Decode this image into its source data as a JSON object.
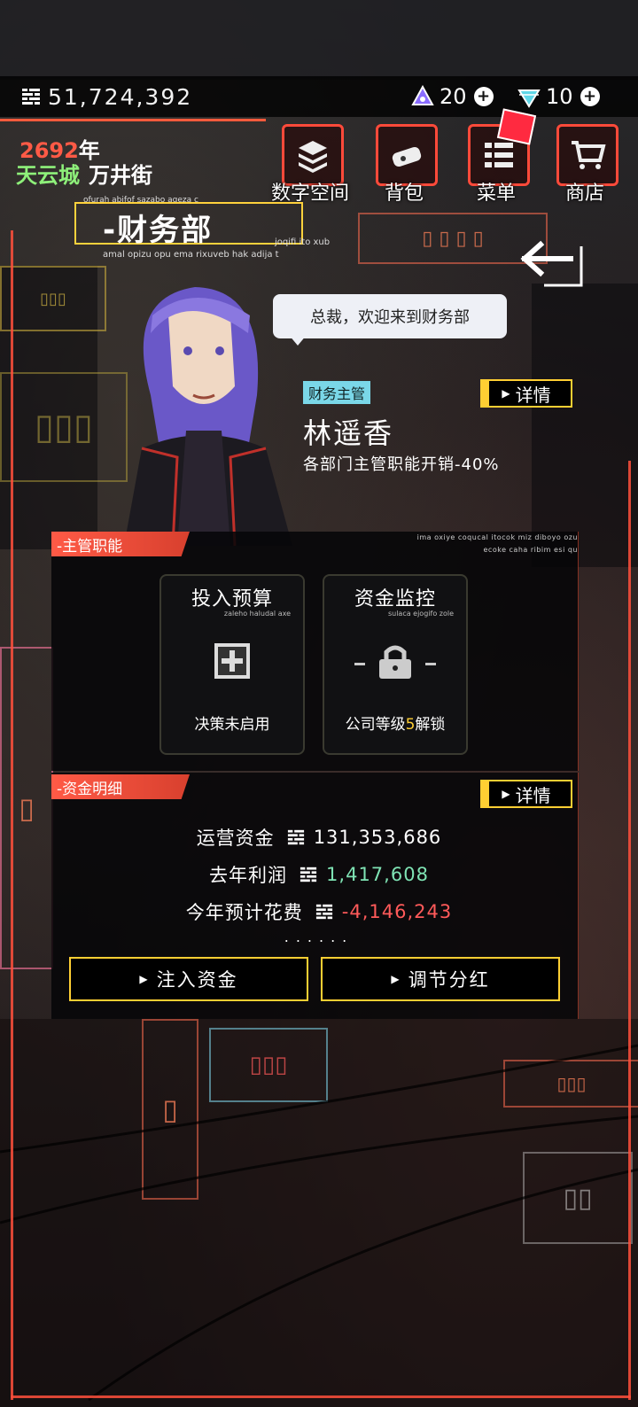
{
  "topbar": {
    "money": "51,724,392",
    "crystal_count": "20",
    "diamond_count": "10"
  },
  "header": {
    "year_number": "2692",
    "year_suffix": "年",
    "city": "天云城",
    "street": "万井街"
  },
  "nav": [
    {
      "label": "数字空间",
      "icon": "digital-space-icon"
    },
    {
      "label": "背包",
      "icon": "backpack-icon"
    },
    {
      "label": "菜单",
      "icon": "menu-icon"
    },
    {
      "label": "商店",
      "icon": "shop-cart-icon"
    }
  ],
  "department": {
    "deco_top": "ofurah abifof sazabo aqeza c",
    "title": "-财务部",
    "deco_right": "joqifi ito xub",
    "deco_bottom": "amal opizu opu ema rixuveb hak adija t"
  },
  "greeting": "总裁，欢迎来到财务部",
  "manager": {
    "role_tag": "财务主管",
    "name": "林遥香",
    "effect": "各部门主管职能开销-40%",
    "detail_label": "详情"
  },
  "functions_panel": {
    "tag": "-主管职能",
    "deco_1": "ima oxiye coqucal itocok miz diboyo ozu",
    "deco_2": "ecoke caha ribim esi qu",
    "cards": [
      {
        "title": "投入预算",
        "sub": "zaleho haludal axe",
        "status": "决策未启用",
        "icon": "plus-box-icon"
      },
      {
        "title": "资金监控",
        "sub": "sulaca ejogifo zole",
        "status_prefix": "公司等级",
        "status_level": "5",
        "status_suffix": "解锁",
        "icon": "lock-icon"
      }
    ]
  },
  "funds_panel": {
    "tag": "-资金明细",
    "detail_label": "详情",
    "rows": [
      {
        "label": "运营资金",
        "value": "131,353,686",
        "color": "#ffffff"
      },
      {
        "label": "去年利润",
        "value": "1,417,608",
        "color": "#7fe3b4"
      },
      {
        "label": "今年预计花费",
        "value": "-4,146,243",
        "color": "#ff5a5a"
      }
    ],
    "more": "......",
    "buttons": [
      "注入资金",
      "调节分红"
    ]
  },
  "colors": {
    "accent": "#ff5a46",
    "gold": "#ffcf33",
    "green": "#8ef07a"
  }
}
